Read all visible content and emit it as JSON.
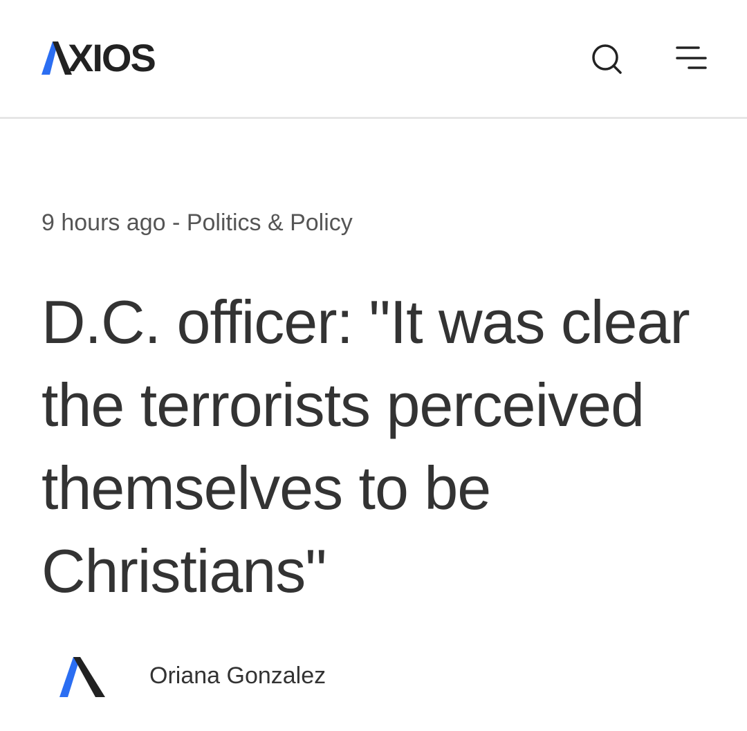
{
  "header": {
    "logo_text": "XIOS",
    "logo_aria": "AXIOS",
    "search_icon": "search-icon",
    "menu_icon": "menu-icon"
  },
  "colors": {
    "brand_blue": "#2b6ef2",
    "ink": "#222222",
    "text": "#333333",
    "muted": "#555555",
    "divider": "#e6e6e6"
  },
  "article": {
    "timestamp": "9 hours ago",
    "separator": " - ",
    "category": "Politics & Policy",
    "headline": "D.C. officer: \"It was clear the terrorists perceived themselves to be Christians\"",
    "author": {
      "avatar_icon": "axios-avatar-icon",
      "name": "Oriana Gonzalez"
    }
  }
}
